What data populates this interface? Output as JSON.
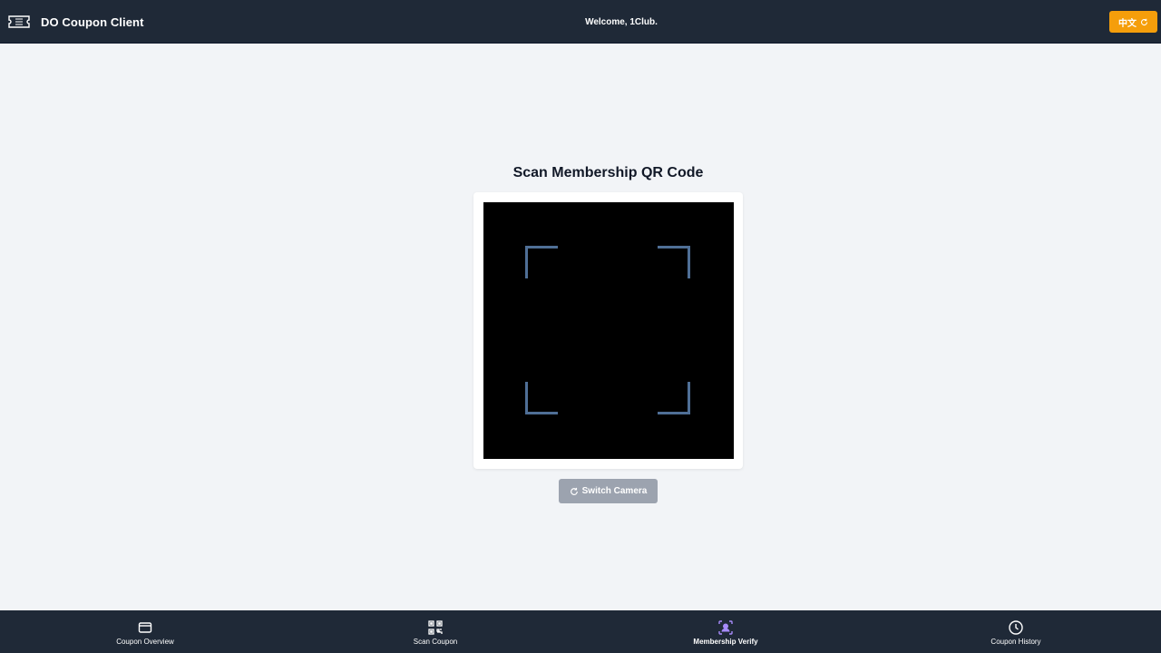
{
  "header": {
    "title": "DO Coupon Client",
    "welcome": "Welcome, 1Club.",
    "language_button": "中文"
  },
  "main": {
    "title": "Scan Membership QR Code",
    "switch_camera_label": "Switch Camera"
  },
  "nav": {
    "items": [
      {
        "label": "Coupon Overview",
        "icon": "ticket-icon",
        "active": false
      },
      {
        "label": "Scan Coupon",
        "icon": "qr-code-icon",
        "active": false
      },
      {
        "label": "Membership Verify",
        "icon": "user-verify-icon",
        "active": true
      },
      {
        "label": "Coupon History",
        "icon": "clock-icon",
        "active": false
      }
    ]
  },
  "colors": {
    "header_bg": "#1f2937",
    "accent_orange": "#f59e0b",
    "active_nav": "#a78bfa",
    "scanner_frame": "#4f6f96",
    "disabled_button": "#9ca3af"
  }
}
